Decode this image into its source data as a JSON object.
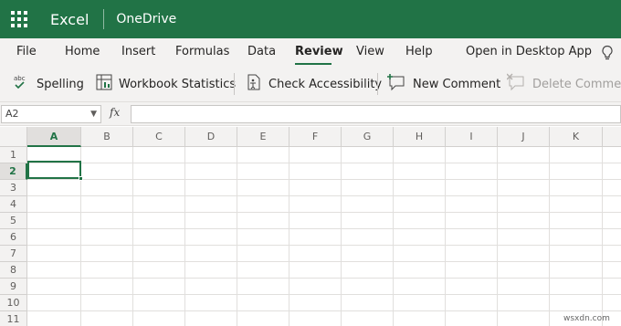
{
  "titlebar": {
    "app_name": "Excel",
    "location": "OneDrive",
    "color": "#217346"
  },
  "menu": {
    "tabs": [
      "File",
      "Home",
      "Insert",
      "Formulas",
      "Data",
      "Review",
      "View",
      "Help",
      "Open in Desktop App"
    ],
    "active_tab": "Review",
    "help_icon": "lightbulb-icon"
  },
  "ribbon": {
    "spelling": "Spelling",
    "spelling_icon_text": "abc",
    "workbook_statistics": "Workbook Statistics",
    "check_accessibility": "Check Accessibility",
    "new_comment": "New Comment",
    "delete_comment": "Delete Comment"
  },
  "formula_bar": {
    "name_box": "A2",
    "fx_label": "fx",
    "formula": ""
  },
  "sheet": {
    "columns": [
      "A",
      "B",
      "C",
      "D",
      "E",
      "F",
      "G",
      "H",
      "I",
      "J",
      "K"
    ],
    "rows": [
      "1",
      "2",
      "3",
      "4",
      "5",
      "6",
      "7",
      "8",
      "9",
      "10",
      "11"
    ],
    "selected_column": "A",
    "selected_row": "2",
    "active_cell": "A2"
  },
  "watermark": "wsxdn.com"
}
